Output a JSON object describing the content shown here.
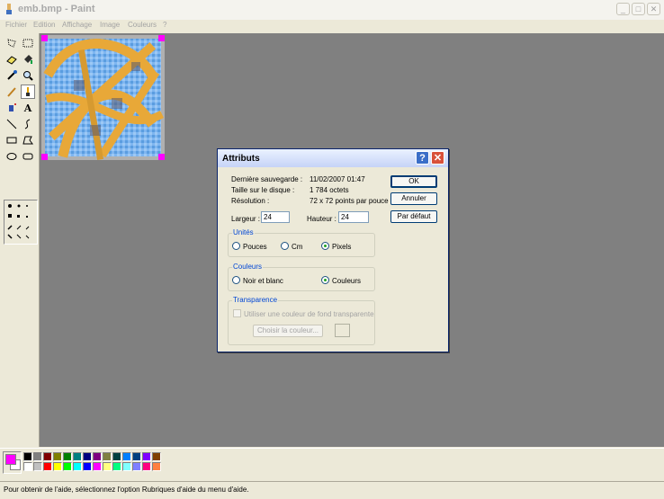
{
  "window": {
    "title": "emb.bmp - Paint",
    "controls": [
      "minimize",
      "maximize",
      "close"
    ]
  },
  "menu": [
    "Fichier",
    "Edition",
    "Affichage",
    "Image",
    "Couleurs",
    "?"
  ],
  "tools": [
    "free-select",
    "rect-select",
    "eraser",
    "fill",
    "color-picker",
    "magnifier",
    "pencil",
    "brush",
    "airbrush",
    "text",
    "line",
    "curve",
    "rectangle",
    "polygon",
    "ellipse",
    "rounded-rectangle"
  ],
  "colors": {
    "accent": "#ff00ff",
    "palette": [
      "#000000",
      "#808080",
      "#800000",
      "#808000",
      "#008000",
      "#008080",
      "#000080",
      "#800080",
      "#808040",
      "#004040",
      "#0080ff",
      "#004080",
      "#8000ff",
      "#804000",
      "#ffffff",
      "#c0c0c0",
      "#ff0000",
      "#ffff00",
      "#00ff00",
      "#00ffff",
      "#0000ff",
      "#ff00ff",
      "#ffff80",
      "#00ff80",
      "#80ffff",
      "#8080ff",
      "#ff0080",
      "#ff8040"
    ]
  },
  "status": "Pour obtenir de l'aide, sélectionnez l'option Rubriques d'aide du menu d'aide.",
  "dialog": {
    "title": "Attributs",
    "info": {
      "last_saved_label": "Dernière sauvegarde :",
      "last_saved_value": "11/02/2007 01:47",
      "disk_size_label": "Taille sur le disque :",
      "disk_size_value": "1 784 octets",
      "resolution_label": "Résolution :",
      "resolution_value": "72 x 72 points par pouce"
    },
    "width_label": "Largeur :",
    "width_value": "24",
    "height_label": "Hauteur :",
    "height_value": "24",
    "units": {
      "title": "Unités",
      "options": [
        "Pouces",
        "Cm",
        "Pixels"
      ],
      "selected": "Pixels"
    },
    "colors_group": {
      "title": "Couleurs",
      "options": [
        "Noir et blanc",
        "Couleurs"
      ],
      "selected": "Couleurs"
    },
    "transparency": {
      "title": "Transparence",
      "checkbox_label": "Utiliser une couleur de fond transparente",
      "choose_button": "Choisir la couleur..."
    },
    "buttons": {
      "ok": "OK",
      "cancel": "Annuler",
      "default": "Par défaut"
    }
  }
}
